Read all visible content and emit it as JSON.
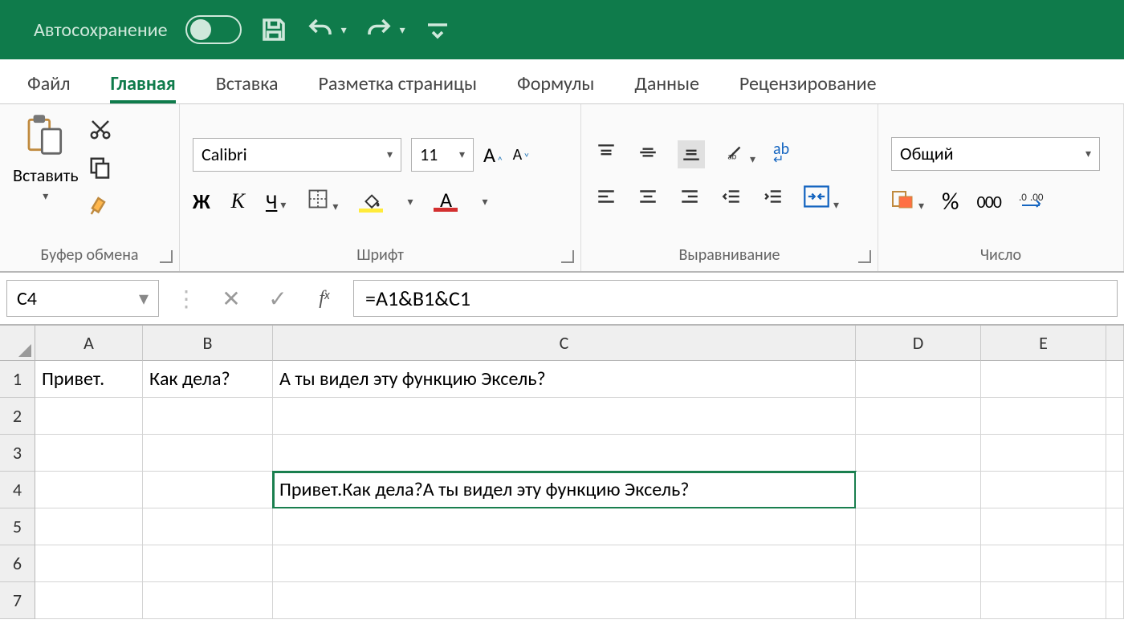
{
  "titlebar": {
    "autosave_label": "Автосохранение"
  },
  "tabs": {
    "file": "Файл",
    "home": "Главная",
    "insert": "Вставка",
    "layout": "Разметка страницы",
    "formulas": "Формулы",
    "data": "Данные",
    "review": "Рецензирование"
  },
  "ribbon": {
    "clipboard": {
      "label": "Буфер обмена",
      "paste": "Вставить"
    },
    "font": {
      "label": "Шрифт",
      "name": "Calibri",
      "size": "11",
      "bold": "Ж",
      "italic": "К",
      "underline": "Ч"
    },
    "alignment": {
      "label": "Выравнивание"
    },
    "number": {
      "label": "Число",
      "format": "Общий",
      "percent": "%",
      "thousands": "000"
    }
  },
  "namebox": "C4",
  "formula": "=A1&B1&C1",
  "grid": {
    "columns": [
      "A",
      "B",
      "C",
      "D",
      "E"
    ],
    "rows": [
      "1",
      "2",
      "3",
      "4",
      "5",
      "6",
      "7"
    ],
    "cells": {
      "A1": "Привет.",
      "B1": "Как  дела?",
      "C1": "А ты видел эту функцию Эксель?",
      "C4": "Привет.Как  дела?А ты видел эту функцию Эксель?"
    },
    "selected": "C4"
  }
}
